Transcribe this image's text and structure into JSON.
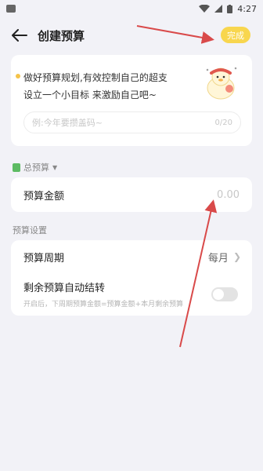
{
  "status_bar": {
    "time": "4:27"
  },
  "header": {
    "title": "创建预算",
    "done_label": "完成"
  },
  "tip": {
    "line1": "做好预算规划,有效控制自己的超支",
    "line2": "设立一个小目标 来激励自己吧~"
  },
  "note": {
    "placeholder": "例:今年要攒盖码~",
    "counter": "0/20"
  },
  "total_section": {
    "label": "总预算",
    "amount_label": "预算金额",
    "amount_placeholder": "0.00"
  },
  "settings_section": {
    "label": "预算设置",
    "period_label": "预算周期",
    "period_value": "每月",
    "rollover_title": "剩余预算自动结转",
    "rollover_desc": "开启后，下周期预算金额=预算金额+本月剩余预算"
  },
  "colors": {
    "accent": "#f8d64e",
    "annotation_arrow": "#d94a4a",
    "background": "#f2f2f7"
  }
}
